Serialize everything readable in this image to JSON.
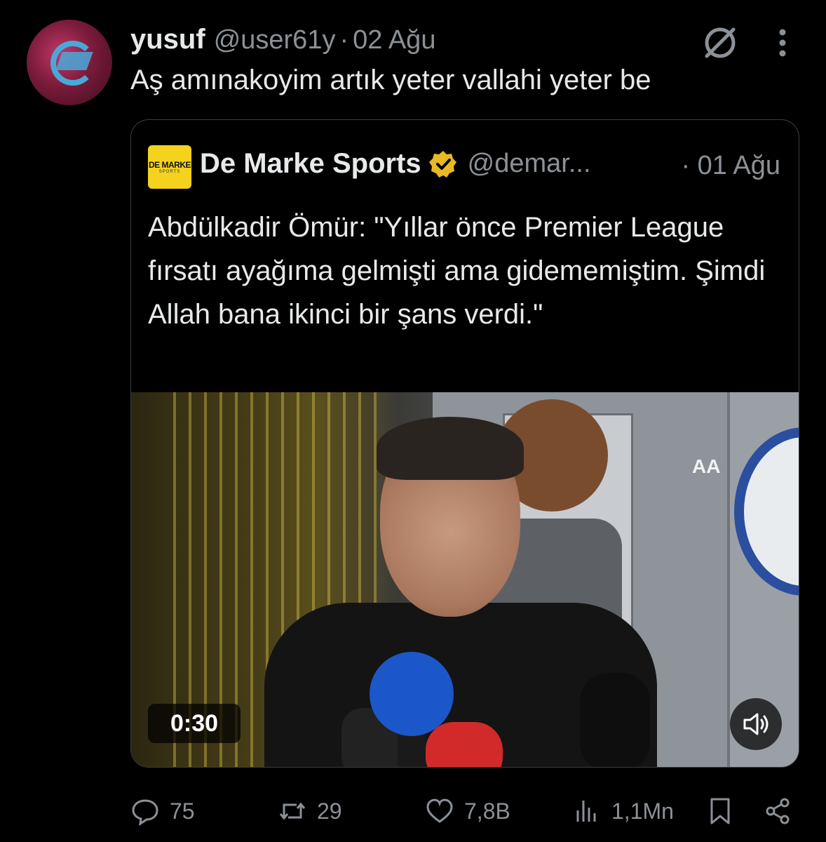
{
  "tweet": {
    "author_name": "yusuf",
    "author_handle": "@user61y",
    "separator": "·",
    "date": "02 Ağu",
    "text": "Aş amınakoyim artık yeter vallahi yeter be"
  },
  "quoted": {
    "logo_text": "DE MARKE",
    "logo_sub": "SPORTS",
    "author_name": "De Marke Sports",
    "author_handle": "@demar...",
    "date": "· 01 Ağu",
    "text": "Abdülkadir Ömür: \"Yıllar önce Premier League fırsatı ayağıma gelmişti ama gidememiştim. Şimdi Allah bana ikinci bir şans verdi.\"",
    "video": {
      "duration": "0:30",
      "watermark": "AA"
    }
  },
  "actions": {
    "replies": "75",
    "reposts": "29",
    "likes": "7,8B",
    "views": "1,1Mn"
  },
  "colors": {
    "background": "#000000",
    "text": "#e7e9ea",
    "secondary": "#8b9197",
    "border": "#3a3d41",
    "badge_gold": "#e8b923",
    "logo_yellow": "#f5d21d"
  },
  "icons": [
    "grok-icon",
    "more-icon",
    "verified-badge-icon",
    "volume-icon",
    "reply-icon",
    "repost-icon",
    "like-icon",
    "views-icon",
    "bookmark-icon",
    "share-icon"
  ]
}
